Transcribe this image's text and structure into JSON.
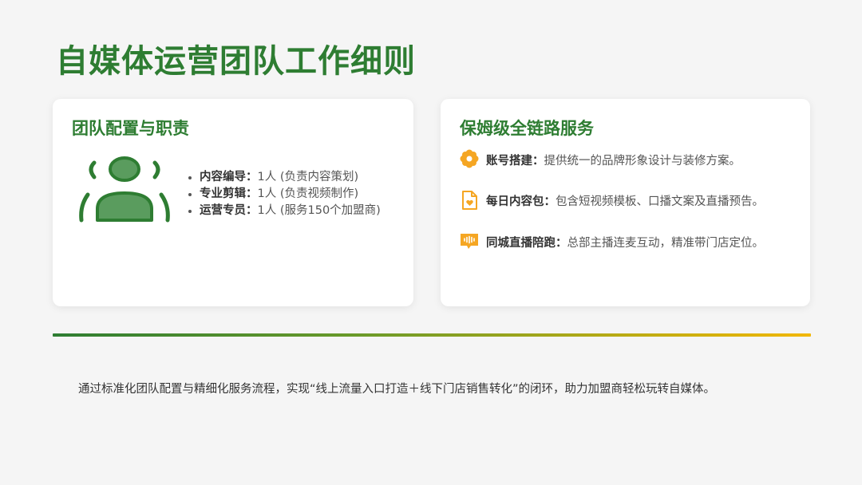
{
  "title": "自媒体运营团队工作细则",
  "team_card": {
    "title": "团队配置与职责",
    "icon": "team-people-icon",
    "roles": [
      {
        "name": "内容编导：",
        "desc": "1人 (负责内容策划)"
      },
      {
        "name": "专业剪辑：",
        "desc": "1人 (负责视频制作)"
      },
      {
        "name": "运营专员：",
        "desc": "1人 (服务150个加盟商)"
      }
    ]
  },
  "service_card": {
    "title": "保姆级全链路服务",
    "items": [
      {
        "icon": "flower-gear-icon",
        "name": "账号搭建：",
        "desc": "提供统一的品牌形象设计与装修方案。"
      },
      {
        "icon": "document-heart-icon",
        "name": "每日内容包：",
        "desc": "包含短视频模板、口播文案及直播预告。"
      },
      {
        "icon": "live-broadcast-icon",
        "name": "同城直播陪跑：",
        "desc": "总部主播连麦互动，精准带门店定位。"
      }
    ]
  },
  "summary": "通过标准化团队配置与精细化服务流程，实现“线上流量入口打造＋线下门店销售转化”的闭环，助力加盟商轻松玩转自媒体。",
  "colors": {
    "primary_green": "#2e7d32",
    "icon_green": "#5a9c5e",
    "accent_orange": "#f5a623",
    "background": "#f5f5f5"
  }
}
